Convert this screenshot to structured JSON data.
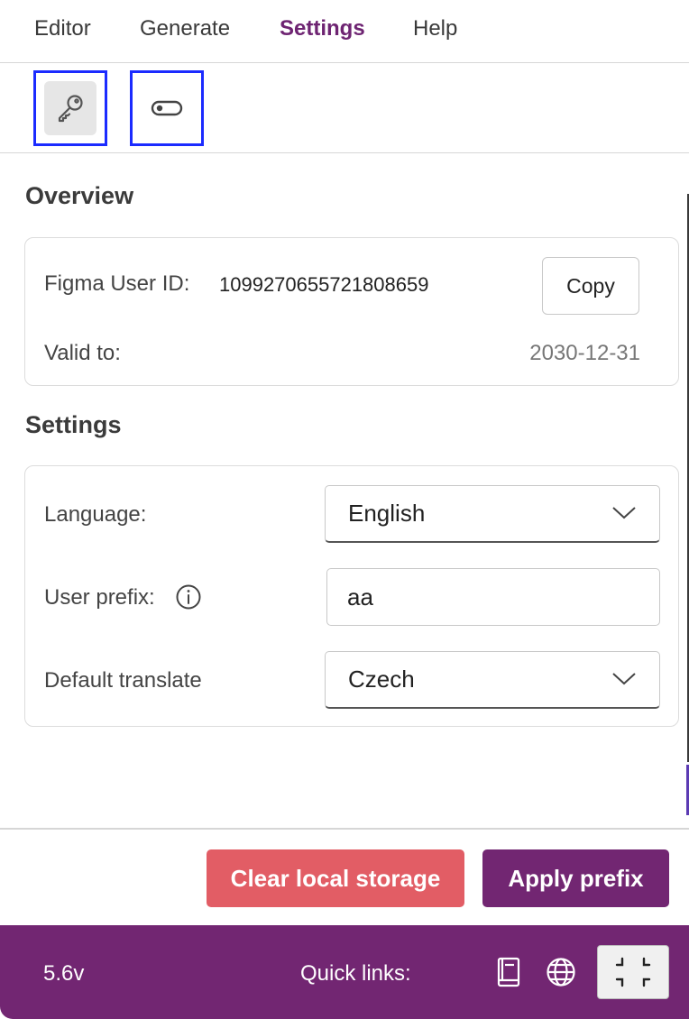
{
  "tabs": [
    {
      "label": "Editor",
      "active": false
    },
    {
      "label": "Generate",
      "active": false
    },
    {
      "label": "Settings",
      "active": true
    },
    {
      "label": "Help",
      "active": false
    }
  ],
  "toolbar": {
    "icons": [
      "key-icon",
      "toggle-icon"
    ]
  },
  "overview": {
    "title": "Overview",
    "user_id_label": "Figma User ID:",
    "user_id_value": "1099270655721808659",
    "copy_label": "Copy",
    "valid_label": "Valid to:",
    "valid_value": "2030-12-31"
  },
  "settings": {
    "title": "Settings",
    "language_label": "Language:",
    "language_value": "English",
    "prefix_label": "User prefix:",
    "prefix_value": "aa",
    "translate_label": "Default translate",
    "translate_value": "Czech"
  },
  "actions": {
    "clear_label": "Clear local storage",
    "apply_label": "Apply prefix"
  },
  "footer": {
    "version": "5.6v",
    "quick_links_label": "Quick links:",
    "icons": [
      "book-icon",
      "globe-icon",
      "collapse-icon"
    ]
  },
  "colors": {
    "brand": "#722672",
    "danger": "#e25d65",
    "highlight": "#1b2bff"
  }
}
